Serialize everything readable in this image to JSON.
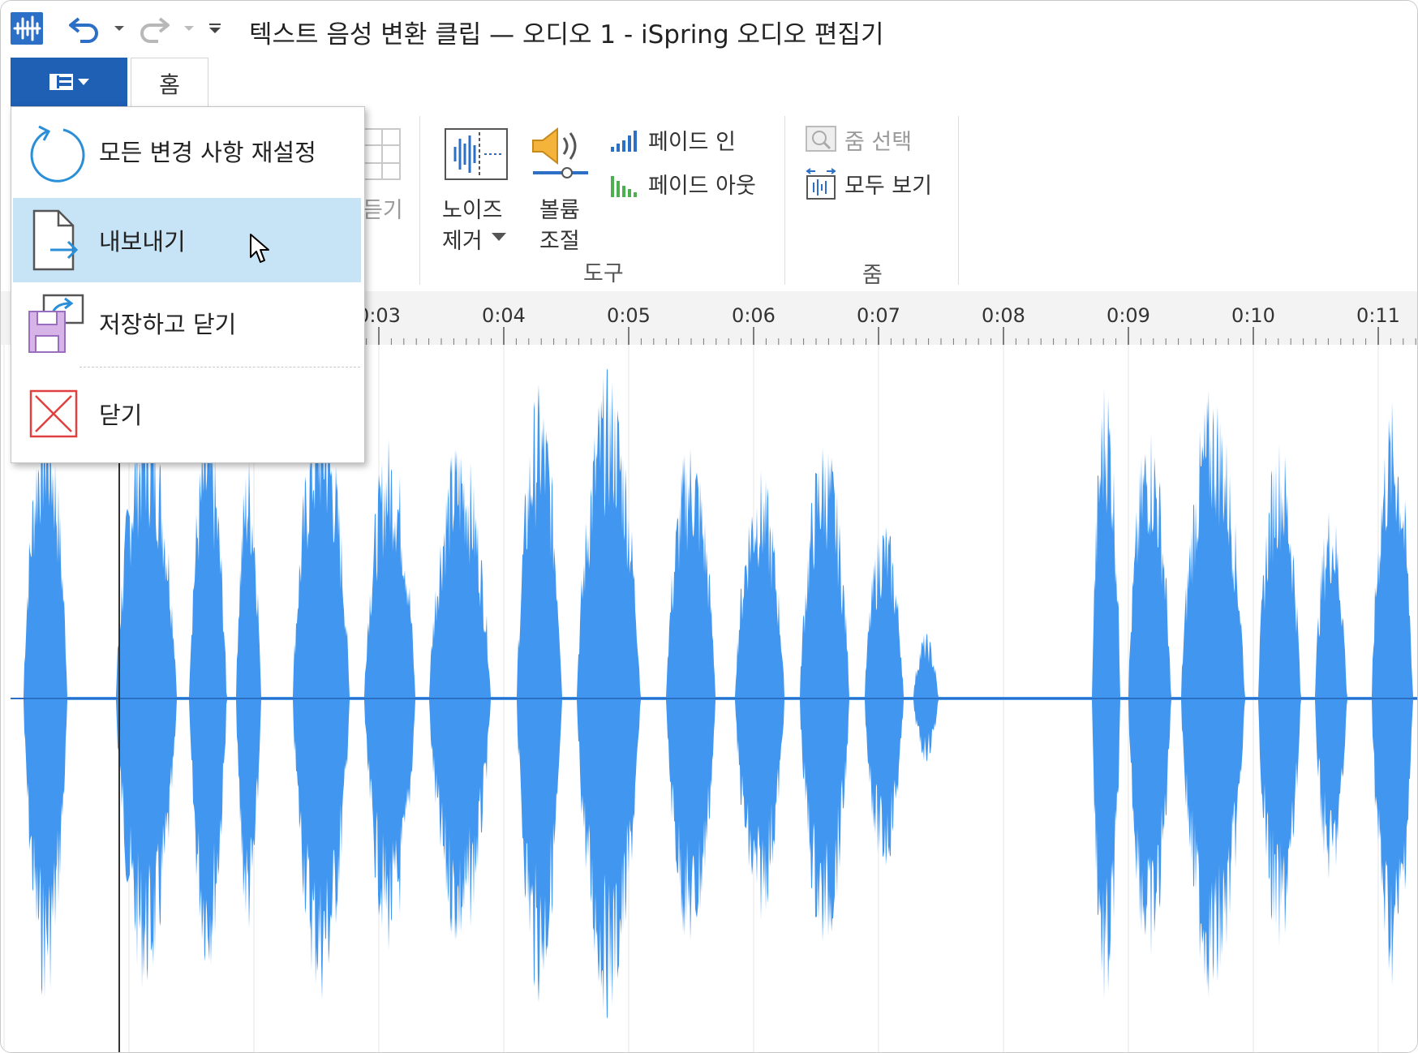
{
  "window": {
    "title": "텍스트 음성 변환 클립 — 오디오 1 - iSpring 오디오 편집기"
  },
  "tabs": {
    "home": "홈"
  },
  "file_menu": {
    "items": [
      {
        "label": "모든 변경 사항 재설정",
        "icon": "reset-icon"
      },
      {
        "label": "내보내기",
        "icon": "export-icon",
        "highlighted": true
      },
      {
        "label": "저장하고 닫기",
        "icon": "save-close-icon"
      },
      {
        "label": "닫기",
        "icon": "close-icon"
      }
    ]
  },
  "ribbon": {
    "partial_label": "듣기",
    "noise_removal": {
      "line1": "노이즈",
      "line2": "제거"
    },
    "volume": {
      "line1": "볼륨",
      "line2": "조절"
    },
    "fade_in": "페이드 인",
    "fade_out": "페이드 아웃",
    "tools_group": "도구",
    "zoom_selection": "줌 선택",
    "view_all": "모두 보기",
    "zoom_group": "줌"
  },
  "timeline": {
    "ticks": [
      "0:03",
      "0:04",
      "0:05",
      "0:06",
      "0:07",
      "0:08",
      "0:09",
      "0:10",
      "0:11"
    ]
  },
  "colors": {
    "accent": "#1f5fb4",
    "waveform": "#4197f0",
    "menu_highlight": "#c7e4f7"
  }
}
